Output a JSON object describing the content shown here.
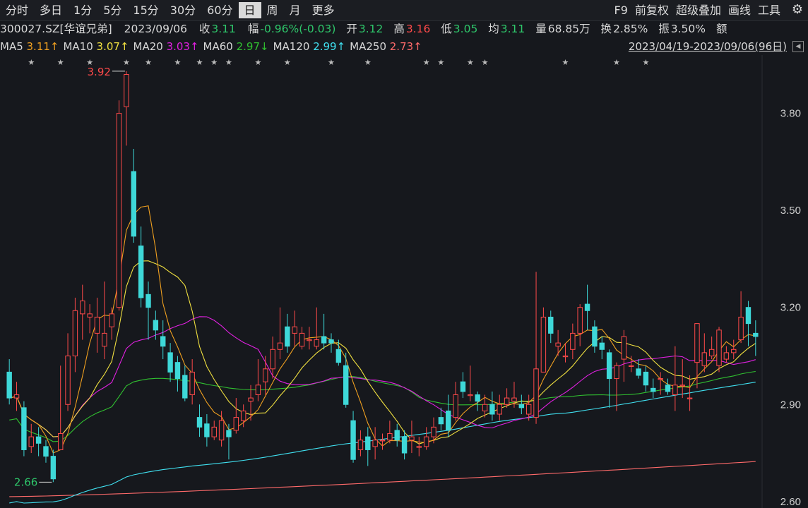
{
  "toolbar": {
    "tabs": [
      "分时",
      "多日",
      "1分",
      "5分",
      "15分",
      "30分",
      "60分",
      "日",
      "周",
      "月",
      "更多"
    ],
    "active_tab": "日",
    "tools": [
      "F9",
      "前复权",
      "超级叠加",
      "画线",
      "工具"
    ],
    "settings_icon": "gear-icon"
  },
  "quote": {
    "code": "300027.SZ[华谊兄弟]",
    "date": "2023/09/06",
    "close_label": "收",
    "close": "3.11",
    "change_label": "幅",
    "change": "-0.96%(-0.03)",
    "open_label": "开",
    "open": "3.12",
    "high_label": "高",
    "high": "3.16",
    "low_label": "低",
    "low": "3.05",
    "avg_label": "均",
    "avg": "3.11",
    "volume_label": "量",
    "volume": "68.85万",
    "turnover_label": "换",
    "turnover": "2.85%",
    "amplitude_label": "振",
    "amplitude": "3.50%",
    "amount_label": "额"
  },
  "ma_legend": [
    {
      "name": "MA5",
      "value": "3.11↑",
      "color": "#f0a020"
    },
    {
      "name": "MA10",
      "value": "3.07↑",
      "color": "#f0e040"
    },
    {
      "name": "MA20",
      "value": "3.03↑",
      "color": "#e020e0"
    },
    {
      "name": "MA60",
      "value": "2.97↓",
      "color": "#30c030"
    },
    {
      "name": "MA120",
      "value": "2.99↑",
      "color": "#40e0f0"
    },
    {
      "name": "MA250",
      "value": "2.73↑",
      "color": "#ff6a6a"
    }
  ],
  "range": "2023/04/19-2023/09/06(96日)",
  "colors": {
    "up": "#ff4a4a",
    "down": "#3ed8d8",
    "bg": "#16181d"
  },
  "chart_data": {
    "type": "candlestick",
    "ylim": [
      2.58,
      3.98
    ],
    "y_ticks": [
      "3.80",
      "3.50",
      "3.20",
      "2.90",
      "2.60"
    ],
    "max_label": "3.92",
    "min_label": "2.66",
    "candles": [
      [
        3.0,
        2.92,
        3.04,
        2.9
      ],
      [
        2.92,
        2.93,
        2.97,
        2.88
      ],
      [
        2.89,
        2.76,
        2.91,
        2.74
      ],
      [
        2.77,
        2.8,
        2.84,
        2.75
      ],
      [
        2.8,
        2.78,
        2.83,
        2.74
      ],
      [
        2.77,
        2.74,
        2.79,
        2.72
      ],
      [
        2.74,
        2.67,
        2.76,
        2.66
      ],
      [
        2.76,
        2.81,
        3.02,
        2.76
      ],
      [
        2.9,
        3.05,
        3.12,
        2.88
      ],
      [
        3.05,
        3.19,
        3.23,
        3.0
      ],
      [
        3.18,
        3.22,
        3.27,
        3.1
      ],
      [
        3.17,
        3.18,
        3.21,
        3.12
      ],
      [
        3.12,
        3.17,
        3.23,
        3.06
      ],
      [
        3.08,
        3.12,
        3.28,
        3.04
      ],
      [
        3.14,
        3.18,
        3.2,
        3.1
      ],
      [
        3.2,
        3.8,
        3.84,
        3.19
      ],
      [
        3.82,
        3.92,
        3.93,
        3.7
      ],
      [
        3.62,
        3.42,
        3.69,
        3.4
      ],
      [
        3.39,
        3.23,
        3.45,
        3.2
      ],
      [
        3.24,
        3.2,
        3.28,
        3.1
      ],
      [
        3.16,
        3.13,
        3.19,
        3.1
      ],
      [
        3.11,
        3.08,
        3.16,
        3.04
      ],
      [
        3.06,
        3.0,
        3.09,
        2.97
      ],
      [
        3.03,
        2.98,
        3.05,
        2.94
      ],
      [
        2.99,
        2.92,
        3.02,
        2.91
      ],
      [
        2.93,
        3.0,
        3.04,
        2.9
      ],
      [
        2.86,
        2.83,
        2.9,
        2.8
      ],
      [
        2.84,
        2.8,
        2.87,
        2.77
      ],
      [
        2.8,
        2.83,
        2.85,
        2.79
      ],
      [
        2.79,
        2.85,
        2.88,
        2.77
      ],
      [
        2.82,
        2.8,
        2.84,
        2.73
      ],
      [
        2.82,
        2.86,
        2.92,
        2.81
      ],
      [
        2.85,
        2.88,
        2.9,
        2.83
      ],
      [
        2.91,
        2.92,
        2.96,
        2.85
      ],
      [
        2.93,
        2.96,
        3.04,
        2.91
      ],
      [
        2.97,
        3.01,
        3.05,
        2.93
      ],
      [
        3.01,
        3.07,
        3.11,
        2.98
      ],
      [
        3.07,
        3.09,
        3.2,
        3.04
      ],
      [
        3.14,
        3.08,
        3.18,
        3.06
      ],
      [
        3.12,
        3.14,
        3.19,
        3.08
      ],
      [
        3.08,
        3.12,
        3.14,
        3.07
      ],
      [
        3.1,
        3.1,
        3.14,
        3.07
      ],
      [
        3.08,
        3.1,
        3.2,
        3.07
      ],
      [
        3.11,
        3.09,
        3.18,
        3.07
      ],
      [
        3.1,
        3.09,
        3.12,
        3.06
      ],
      [
        3.07,
        3.03,
        3.1,
        3.02
      ],
      [
        3.02,
        2.9,
        3.06,
        2.89
      ],
      [
        2.85,
        2.73,
        2.88,
        2.72
      ],
      [
        2.76,
        2.79,
        2.82,
        2.74
      ],
      [
        2.8,
        2.76,
        2.83,
        2.71
      ],
      [
        2.77,
        2.79,
        2.83,
        2.73
      ],
      [
        2.79,
        2.79,
        2.81,
        2.76
      ],
      [
        2.79,
        2.81,
        2.85,
        2.78
      ],
      [
        2.82,
        2.79,
        2.84,
        2.77
      ],
      [
        2.8,
        2.75,
        2.82,
        2.73
      ],
      [
        2.79,
        2.8,
        2.85,
        2.75
      ],
      [
        2.77,
        2.77,
        2.8,
        2.74
      ],
      [
        2.77,
        2.8,
        2.83,
        2.76
      ],
      [
        2.8,
        2.83,
        2.86,
        2.78
      ],
      [
        2.86,
        2.84,
        2.89,
        2.82
      ],
      [
        2.88,
        2.82,
        2.93,
        2.8
      ],
      [
        2.86,
        2.93,
        2.97,
        2.85
      ],
      [
        2.97,
        2.94,
        3.0,
        2.92
      ],
      [
        2.93,
        2.93,
        3.02,
        2.91
      ],
      [
        2.93,
        2.91,
        2.94,
        2.88
      ],
      [
        2.88,
        2.9,
        2.93,
        2.86
      ],
      [
        2.9,
        2.87,
        2.94,
        2.85
      ],
      [
        2.87,
        2.9,
        2.93,
        2.85
      ],
      [
        2.9,
        2.92,
        2.95,
        2.89
      ],
      [
        2.91,
        2.92,
        2.97,
        2.89
      ],
      [
        2.9,
        2.89,
        2.93,
        2.87
      ],
      [
        2.87,
        2.9,
        2.93,
        2.85
      ],
      [
        2.86,
        3.01,
        3.31,
        2.84
      ],
      [
        3.0,
        3.17,
        3.2,
        3.03
      ],
      [
        3.17,
        3.12,
        3.19,
        3.09
      ],
      [
        3.08,
        3.09,
        3.13,
        3.05
      ],
      [
        3.05,
        3.05,
        3.09,
        3.03
      ],
      [
        3.07,
        3.12,
        3.15,
        3.04
      ],
      [
        3.12,
        3.2,
        3.21,
        3.08
      ],
      [
        3.21,
        3.19,
        3.27,
        3.13
      ],
      [
        3.14,
        3.08,
        3.16,
        3.06
      ],
      [
        3.09,
        3.07,
        3.11,
        3.04
      ],
      [
        3.06,
        2.98,
        3.07,
        2.89
      ],
      [
        2.98,
        3.02,
        3.03,
        2.88
      ],
      [
        3.04,
        3.11,
        3.13,
        2.97
      ],
      [
        3.02,
        3.02,
        3.05,
        3.0
      ],
      [
        3.01,
        2.99,
        3.04,
        2.98
      ],
      [
        3.0,
        2.96,
        3.02,
        2.94
      ],
      [
        2.95,
        2.94,
        2.98,
        2.92
      ],
      [
        2.98,
        2.98,
        3.0,
        2.93
      ],
      [
        2.96,
        2.94,
        2.98,
        2.93
      ],
      [
        2.93,
        2.96,
        3.08,
        2.88
      ],
      [
        2.96,
        2.96,
        3.04,
        2.92
      ],
      [
        2.92,
        2.92,
        2.99,
        2.88
      ],
      [
        3.03,
        3.15,
        3.15,
        2.95
      ],
      [
        3.02,
        3.06,
        3.12,
        3.0
      ],
      [
        3.05,
        3.07,
        3.11,
        3.04
      ],
      [
        3.02,
        3.13,
        3.14,
        3.0
      ],
      [
        3.04,
        3.06,
        3.08,
        3.03
      ],
      [
        3.06,
        3.07,
        3.1,
        3.04
      ],
      [
        3.1,
        3.17,
        3.25,
        3.09
      ],
      [
        3.2,
        3.15,
        3.22,
        3.08
      ],
      [
        3.12,
        3.11,
        3.16,
        3.05
      ]
    ],
    "star_markers": [
      3,
      7,
      11,
      16,
      19,
      23,
      26,
      28,
      30,
      34,
      38,
      44,
      49,
      57,
      59,
      63,
      65,
      76,
      83,
      87
    ]
  }
}
